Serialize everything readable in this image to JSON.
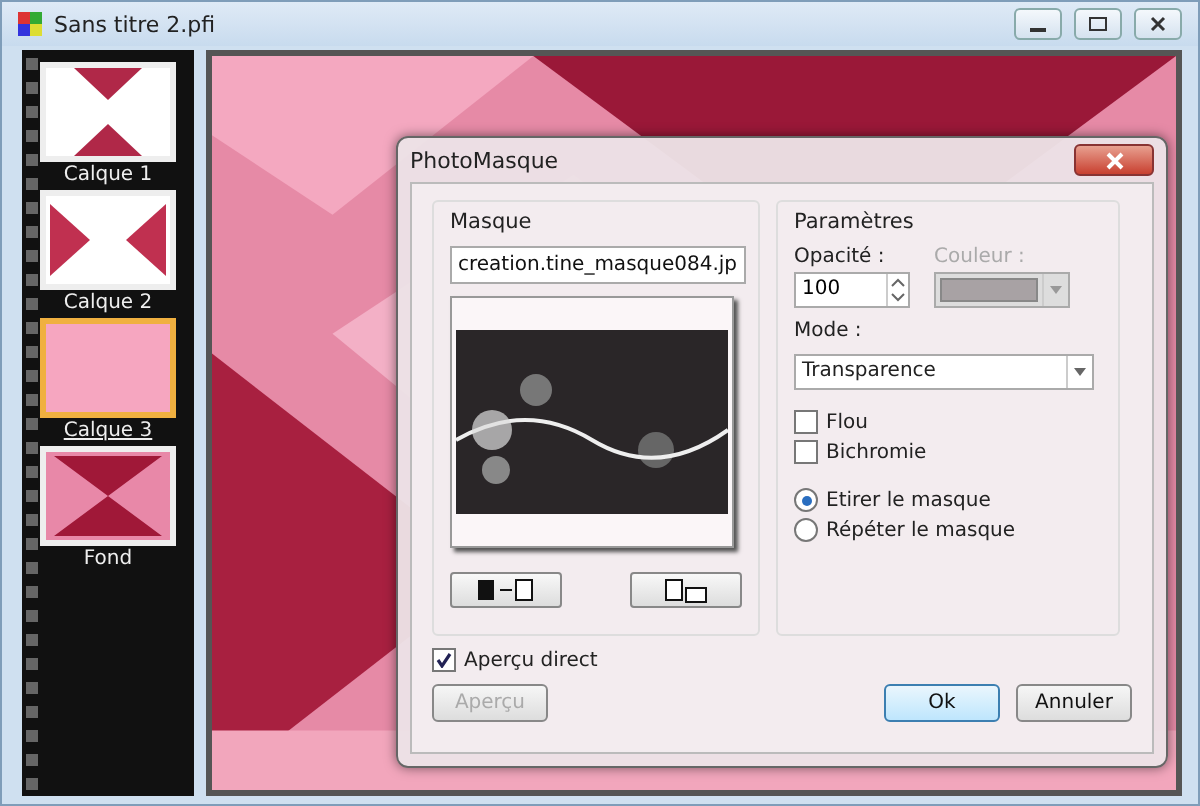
{
  "window": {
    "title": "Sans titre 2.pfi"
  },
  "layers": [
    {
      "name": "Calque 1",
      "selected": false,
      "kind": "vertical"
    },
    {
      "name": "Calque 2",
      "selected": false,
      "kind": "horizontal"
    },
    {
      "name": "Calque 3",
      "selected": true,
      "kind": "plain"
    },
    {
      "name": "Fond",
      "selected": false,
      "kind": "full"
    }
  ],
  "dialog": {
    "title": "PhotoMasque",
    "mask": {
      "heading": "Masque",
      "file": "creation.tine_masque084.jp"
    },
    "params": {
      "heading": "Paramètres",
      "opacity_label": "Opacité :",
      "opacity": "100",
      "color_label": "Couleur :",
      "color_disabled": true,
      "mode_label": "Mode :",
      "mode": "Transparence",
      "checks": [
        {
          "label": "Flou",
          "checked": false
        },
        {
          "label": "Bichromie",
          "checked": false
        }
      ],
      "radios": [
        {
          "label": "Etirer le masque",
          "selected": true
        },
        {
          "label": "Répéter le masque",
          "selected": false
        }
      ]
    },
    "live_preview": {
      "label": "Aperçu direct",
      "checked": true
    },
    "buttons": [
      {
        "label": "Aperçu",
        "disabled": true
      },
      {
        "label": "Ok",
        "disabled": false,
        "default": true
      },
      {
        "label": "Annuler",
        "disabled": false,
        "default": false
      }
    ]
  }
}
